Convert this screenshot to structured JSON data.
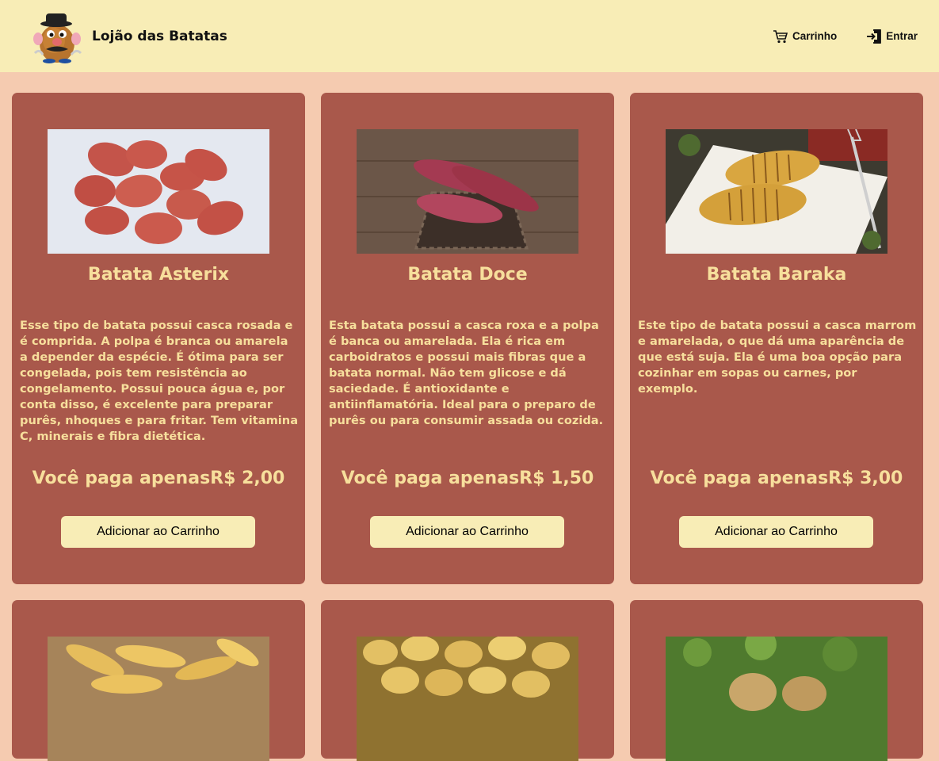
{
  "header": {
    "brand": "Lojão das Batatas",
    "cart_label": "Carrinho",
    "login_label": "Entrar",
    "logo_icon": "potato-head-icon",
    "cart_icon": "cart-icon",
    "login_icon": "login-icon"
  },
  "colors": {
    "background": "#f5cbb0",
    "header": "#f8edb6",
    "card": "#a9584b",
    "card_text": "#f7df9c",
    "button": "#f8edb6"
  },
  "products": [
    {
      "name": "Batata Asterix",
      "description": "Esse tipo de batata possui casca rosada e é comprida. A polpa é branca ou amarela a depender da espécie. É ótima para ser congelada, pois tem resistência ao congelamento. Possui pouca água e, por conta disso, é excelente para preparar purês, nhoques e para fritar. Tem vitamina C, minerais e fibra dietética.",
      "price": "Você paga apenasR$ 2,00",
      "button": "Adicionar ao Carrinho"
    },
    {
      "name": "Batata Doce",
      "description": "Esta batata possui a casca roxa e a polpa é banca ou amarelada. Ela é rica em carboidratos e possui mais fibras que a batata normal. Não tem glicose e dá saciedade. É antioxidante e antiinflamatória. Ideal para o preparo de purês ou para consumir assada ou cozida.",
      "price": "Você paga apenasR$ 1,50",
      "button": "Adicionar ao Carrinho"
    },
    {
      "name": "Batata Baraka",
      "description": "Este tipo de batata possui a casca marrom e amarelada, o que dá uma aparência de que está suja. Ela é uma boa opção para cozinhar em sopas ou carnes, por exemplo.",
      "price": "Você paga apenasR$ 3,00",
      "button": "Adicionar ao Carrinho"
    }
  ]
}
